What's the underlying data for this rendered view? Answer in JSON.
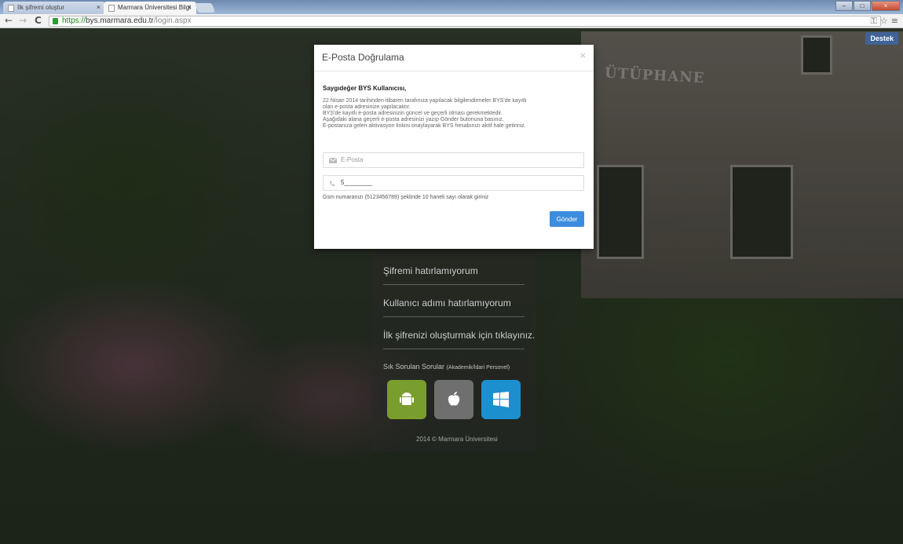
{
  "browser": {
    "tabs": [
      {
        "label": "İlk şifremi oluştur"
      },
      {
        "label": "Marmara Üniversitesi Bilgi"
      }
    ],
    "url_scheme": "https://",
    "url_host": "bys.marmara.edu.tr",
    "url_path": "/login.aspx"
  },
  "page": {
    "support_button": "Destek",
    "building_sign": "ÜTÜPHANE",
    "login_links": [
      "Şifremi hatırlamıyorum",
      "Kullanıcı adımı hatırlamıyorum",
      "İlk şifrenizi oluşturmak için tıklayınız."
    ],
    "faq_label": "Sık Sorulan Sorular",
    "faq_sub": "(Akademik/İdari Personel)",
    "copyright": "2014 © Marmara Üniversitesi",
    "app_icons": [
      "android-icon",
      "apple-icon",
      "windows-icon"
    ]
  },
  "modal": {
    "title": "E-Posta Doğrulama",
    "close": "×",
    "greeting": "Saygıdeğer BYS Kullanıcısı,",
    "info_lines": [
      "22 Nisan 2014 tarihinden itibaren tarafınıza yapılacak bilgilendirmeler BYS'de kayıtlı",
      "olan e-posta adresinize yapılacaktır.",
      "BYS'de kayıtlı e-posta adresinizin güncel ve geçerli olması gerekmektedir.",
      "Aşağıdaki alana geçerli e-posta adresinizi yazıp Gönder butonuna basınız.",
      "E-postanıza gelen aktivasyon linkini onaylayarak BYS hesabınızı aktif hale getiriniz."
    ],
    "email_placeholder": "E-Posta",
    "phone_value": "5________",
    "phone_hint": "Gsm numaranızı (5123456789) şeklinde 10 haneli sayı olarak giriniz",
    "submit_label": "Gönder",
    "submit_color": "#3c8dde"
  }
}
